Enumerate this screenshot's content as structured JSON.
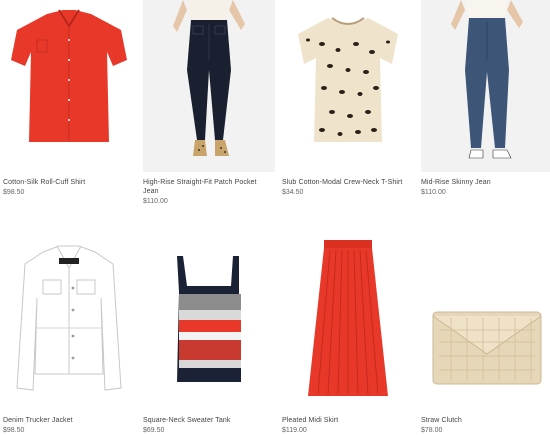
{
  "products": [
    {
      "name": "Cotton-Silk Roll-Cuff Shirt",
      "price": "$98.50",
      "image": "red-shirt-image"
    },
    {
      "name": "High-Rise Straight-Fit Patch Pocket Jean",
      "price": "$110.00",
      "image": "black-jeans-image"
    },
    {
      "name": "Slub Cotton-Modal Crew-Neck T-Shirt",
      "price": "$34.50",
      "image": "leopard-tshirt-image"
    },
    {
      "name": "Mid-Rise Skinny Jean",
      "price": "$110.00",
      "image": "blue-jeans-image"
    },
    {
      "name": "Denim Trucker Jacket",
      "price": "$98.50",
      "image": "white-jacket-image"
    },
    {
      "name": "Square-Neck Sweater Tank",
      "price": "$69.50",
      "image": "sweater-tank-image"
    },
    {
      "name": "Pleated Midi Skirt",
      "price": "$119.00",
      "image": "red-skirt-image"
    },
    {
      "name": "Straw Clutch",
      "price": "$78.00",
      "image": "straw-clutch-image"
    }
  ],
  "colors": {
    "accent_red": "#e8382a",
    "denim_dark": "#1b2030",
    "denim_blue": "#3d5678",
    "straw": "#e6d7b8"
  }
}
